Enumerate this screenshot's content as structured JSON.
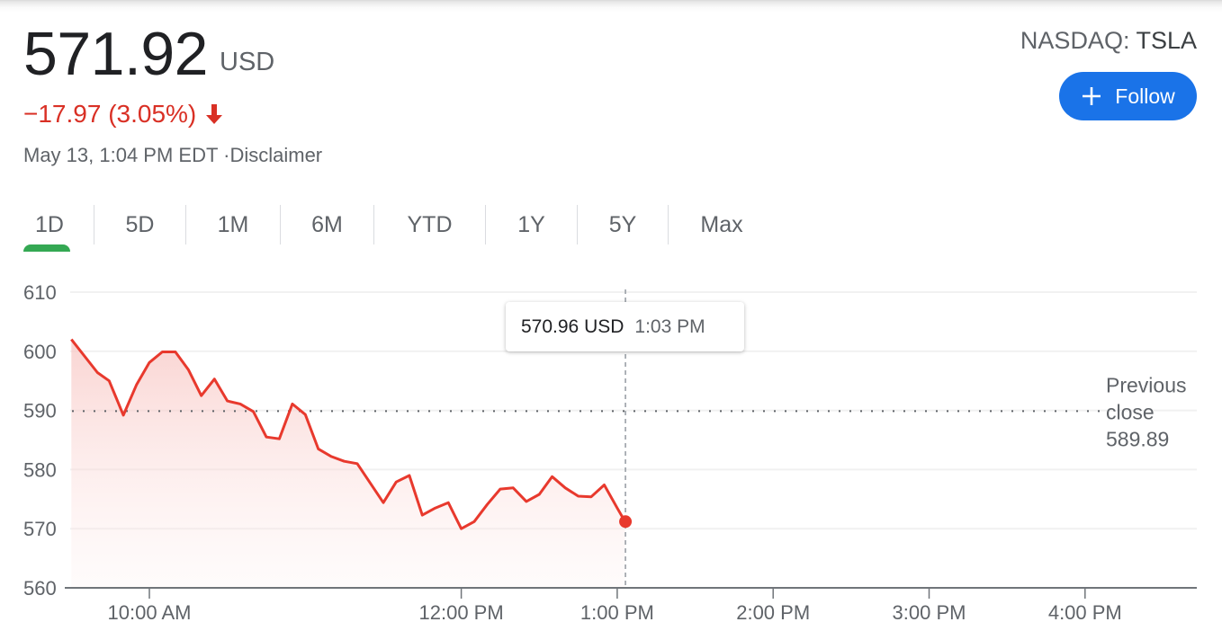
{
  "quote": {
    "price": "571.92",
    "currency": "USD",
    "change": "−17.97 (3.05%)",
    "direction": "down",
    "timestamp": "May 13, 1:04 PM EDT ·",
    "disclaimer_label": "Disclaimer",
    "exchange": "NASDAQ: ",
    "symbol": "TSLA",
    "follow_label": "Follow"
  },
  "colors": {
    "down": "#d93025",
    "accent": "#1a73e8",
    "active_tab": "#34a853",
    "line": "#e8392d"
  },
  "tabs": [
    {
      "label": "1D",
      "active": true
    },
    {
      "label": "5D",
      "active": false
    },
    {
      "label": "1M",
      "active": false
    },
    {
      "label": "6M",
      "active": false
    },
    {
      "label": "YTD",
      "active": false
    },
    {
      "label": "1Y",
      "active": false
    },
    {
      "label": "5Y",
      "active": false
    },
    {
      "label": "Max",
      "active": false
    }
  ],
  "tooltip": {
    "price": "570.96 USD",
    "time": "1:03 PM"
  },
  "chart_data": {
    "type": "line",
    "title": "",
    "xlabel": "",
    "ylabel": "",
    "x_unit": "hours since midnight (ET)",
    "xlim": [
      9.5,
      16.2
    ],
    "ylim": [
      560,
      610
    ],
    "y_ticks": [
      560,
      570,
      580,
      590,
      600,
      610
    ],
    "x_ticks": [
      {
        "value": 10,
        "label": "10:00 AM"
      },
      {
        "value": 12,
        "label": "12:00 PM"
      },
      {
        "value": 13,
        "label": "1:00 PM"
      },
      {
        "value": 14,
        "label": "2:00 PM"
      },
      {
        "value": 15,
        "label": "3:00 PM"
      },
      {
        "value": 16,
        "label": "4:00 PM"
      }
    ],
    "grid": true,
    "previous_close": {
      "value": 589.89,
      "label_lines": [
        "Previous",
        "close",
        "589.89"
      ]
    },
    "hover": {
      "x": 13.05,
      "y": 570.96
    },
    "series": [
      {
        "name": "TSLA",
        "x": [
          9.5,
          9.667,
          9.742,
          9.833,
          9.917,
          10.0,
          10.083,
          10.167,
          10.25,
          10.333,
          10.417,
          10.5,
          10.583,
          10.667,
          10.75,
          10.833,
          10.917,
          11.0,
          11.083,
          11.167,
          11.25,
          11.333,
          11.5,
          11.583,
          11.667,
          11.75,
          11.833,
          11.917,
          12.0,
          12.083,
          12.167,
          12.25,
          12.333,
          12.417,
          12.5,
          12.583,
          12.667,
          12.75,
          12.833,
          12.917,
          13.0,
          13.05
        ],
        "values": [
          602.0,
          596.4,
          595.0,
          589.2,
          594.3,
          598.1,
          599.9,
          599.9,
          596.9,
          592.5,
          595.3,
          591.6,
          591.1,
          589.8,
          585.5,
          585.2,
          591.1,
          589.3,
          583.5,
          582.2,
          581.4,
          581.0,
          574.4,
          577.9,
          579.0,
          572.3,
          573.5,
          574.4,
          570.0,
          571.2,
          574.1,
          576.7,
          576.9,
          574.6,
          575.8,
          578.8,
          576.9,
          575.5,
          575.4,
          577.4,
          573.5,
          571.2
        ]
      }
    ]
  }
}
